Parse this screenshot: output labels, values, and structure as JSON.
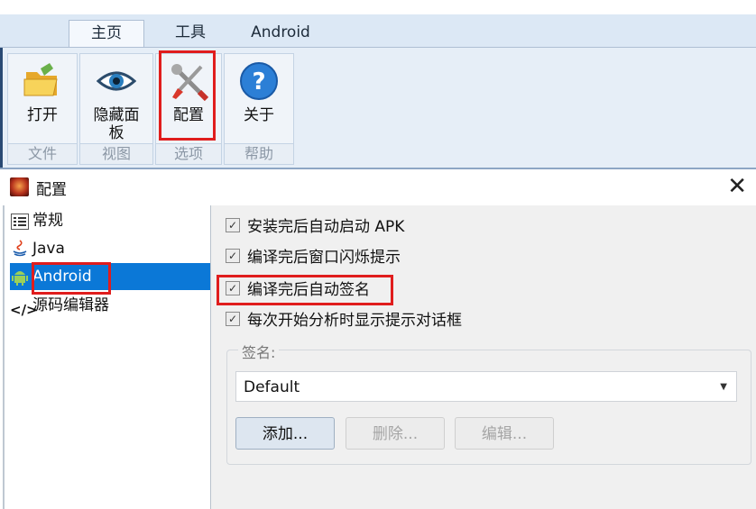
{
  "ribbon": {
    "tabs": [
      "主页",
      "工具",
      "Android"
    ],
    "groups": [
      {
        "label": "文件",
        "buttons": [
          {
            "label": "打开",
            "icon": "open-folder-icon"
          }
        ]
      },
      {
        "label": "视图",
        "buttons": [
          {
            "label": "隐藏面板",
            "icon": "eye-icon"
          }
        ]
      },
      {
        "label": "选项",
        "buttons": [
          {
            "label": "配置",
            "icon": "tools-icon"
          }
        ]
      },
      {
        "label": "帮助",
        "buttons": [
          {
            "label": "关于",
            "icon": "help-icon"
          }
        ]
      }
    ]
  },
  "dialog": {
    "title": "配置",
    "close_glyph": "✕",
    "tree": [
      {
        "label": "常规",
        "icon": "list-icon"
      },
      {
        "label": "Java",
        "icon": "java-icon"
      },
      {
        "label": "Android",
        "icon": "android-icon",
        "selected": true
      },
      {
        "label": "源码编辑器",
        "icon": "code-icon"
      }
    ],
    "options": [
      {
        "label": "安装完后自动启动 APK",
        "checked": true
      },
      {
        "label": "编译完后窗口闪烁提示",
        "checked": true
      },
      {
        "label": "编译完后自动签名",
        "checked": true
      },
      {
        "label": "每次开始分析时显示提示对话框",
        "checked": true
      }
    ],
    "signature": {
      "legend": "签名:",
      "selected": "Default",
      "buttons": [
        {
          "label": "添加...",
          "enabled": true
        },
        {
          "label": "删除...",
          "enabled": false
        },
        {
          "label": "编辑...",
          "enabled": false
        }
      ]
    }
  },
  "colors": {
    "highlight": "#e01d1d",
    "selection": "#0b78d7"
  }
}
